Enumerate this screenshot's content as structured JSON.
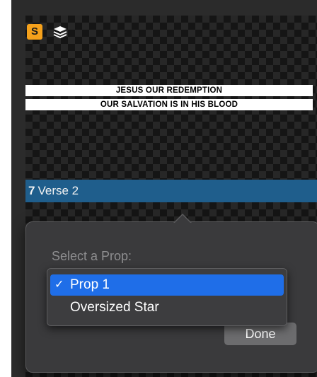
{
  "colors": {
    "badge": "#f5a11b",
    "slide_label_bg": "#1f5e8c",
    "selection_blue": "#1f6ee8",
    "done_button": "#6c6c6e"
  },
  "slide": {
    "badge_letter": "S",
    "layers_icon": "layers-icon",
    "lines": [
      "JESUS OUR REDEMPTION",
      "OUR SALVATION IS IN HIS BLOOD"
    ],
    "number": "7",
    "name": "Verse 2"
  },
  "popover": {
    "prompt": "Select a Prop:",
    "done_label": "Done",
    "options": [
      {
        "label": "Prop 1",
        "checkmark": "✓",
        "selected": true
      },
      {
        "label": "Oversized Star",
        "checkmark": "",
        "selected": false
      }
    ]
  }
}
